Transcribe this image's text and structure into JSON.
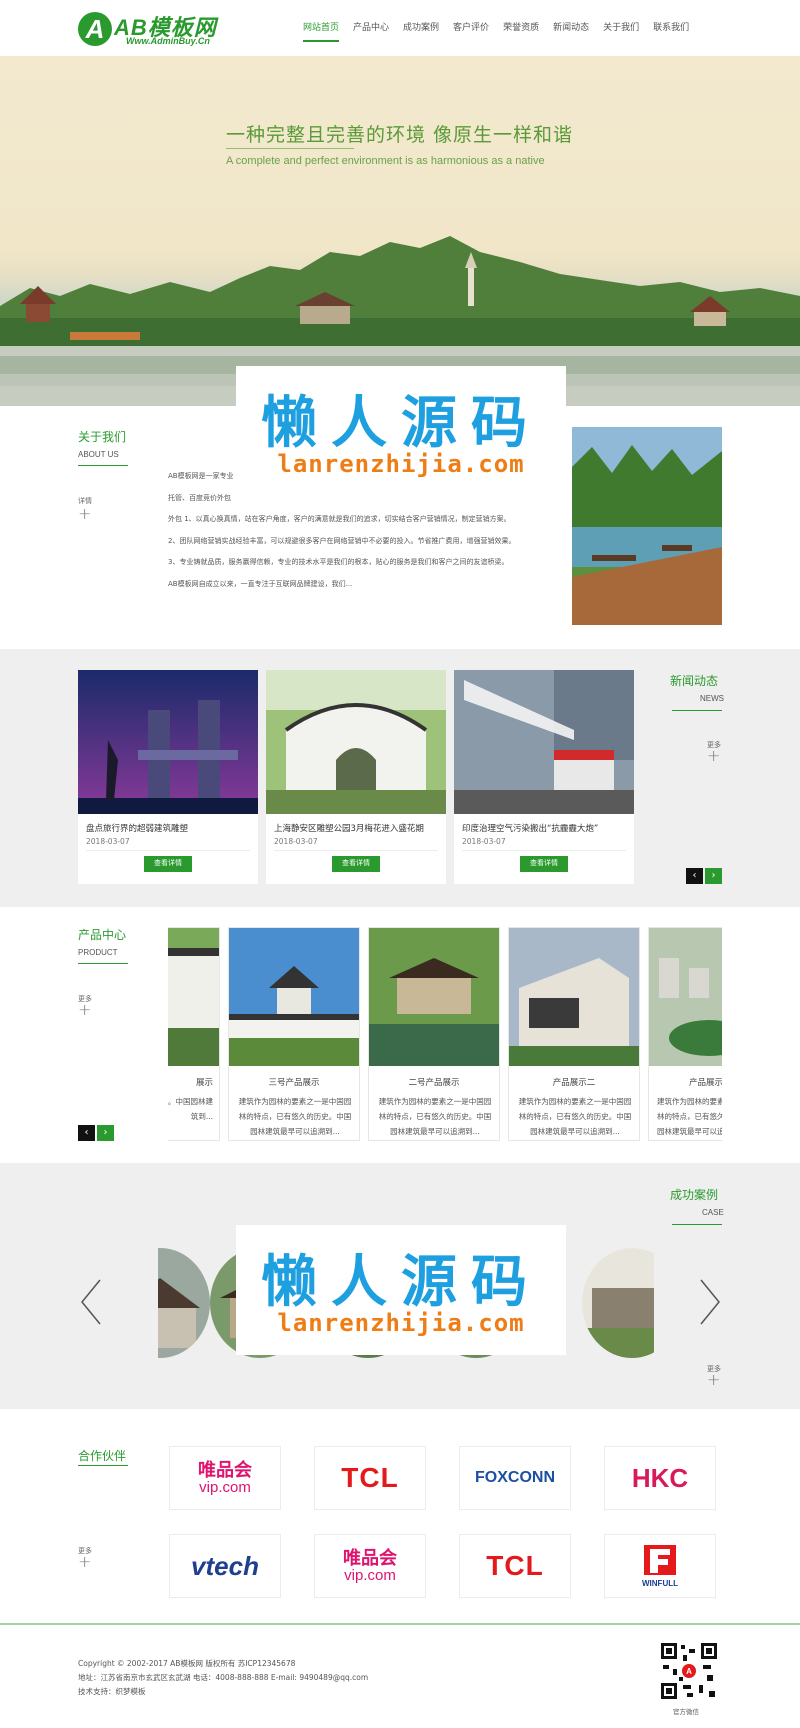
{
  "brand": {
    "logo_letter": "A",
    "name": "AB模板网",
    "url": "Www.AdminBuy.Cn",
    "primary_color": "#2a9a2e"
  },
  "nav": {
    "items": [
      {
        "label": "网站首页",
        "active": true
      },
      {
        "label": "产品中心"
      },
      {
        "label": "成功案例"
      },
      {
        "label": "客户评价"
      },
      {
        "label": "荣誉资质"
      },
      {
        "label": "新闻动态"
      },
      {
        "label": "关于我们"
      },
      {
        "label": "联系我们"
      }
    ]
  },
  "banner": {
    "headline": "一种完整且完善的环境  像原生一样和谐",
    "subline": "A complete and perfect environment is as harmonious as a native"
  },
  "watermark": {
    "cn": "懒人源码",
    "en": "lanrenzhijia.com"
  },
  "about": {
    "title_cn": "关于我们",
    "title_en": "ABOUT US",
    "more": "详情",
    "more_icon": "plus-icon",
    "paragraphs": [
      "AB模板网是一家专业",
      "托管、百度竞价外包",
      "外包 1、以真心换真情，站在客户角度，客户的满意就是我们的追求，切实结合客户营销情况，制定营销方案。",
      "2、团队网络营销实战经验丰富，可以规避很多客户在网络营销中不必要的投入。节省推广费用，增强营销效果。",
      "3、专业铸就品质，服务赢得信赖，专业的技术水平是我们的根本，贴心的服务是我们和客户之间的友谊桥梁。",
      "AB模板网自成立以来，一直专注于互联网品牌建设，我们..."
    ]
  },
  "news": {
    "title_cn": "新闻动态",
    "title_en": "NEWS",
    "more": "更多",
    "button_label": "查看详情",
    "items": [
      {
        "title": "盘点旅行界的超弱建筑雕塑",
        "date": "2018-03-07"
      },
      {
        "title": "上海静安区雕塑公园3月梅花进入盛花期",
        "date": "2018-03-07"
      },
      {
        "title": "印度治理空气污染搬出“抗霾霾大炮”",
        "date": "2018-03-07"
      }
    ],
    "prev_icon": "chevron-left-icon",
    "next_icon": "chevron-right-icon"
  },
  "products": {
    "title_cn": "产品中心",
    "title_en": "PRODUCT",
    "more": "更多",
    "items": [
      {
        "name": "展示",
        "desc": "之一是中国园的历史。中国园林建筑到..."
      },
      {
        "name": "三号产品展示",
        "desc": "建筑作为园林的要素之一是中国园林的特点，已有悠久的历史。中国园林建筑最早可以追溯到..."
      },
      {
        "name": "二号产品展示",
        "desc": "建筑作为园林的要素之一是中国园林的特点，已有悠久的历史。中国园林建筑最早可以追溯到..."
      },
      {
        "name": "产品展示二",
        "desc": "建筑作为园林的要素之一是中国园林的特点，已有悠久的历史。中国园林建筑最早可以追溯到..."
      },
      {
        "name": "产品展示",
        "desc": "建筑作为园林的要素之一是中国园林的特点，已有悠久的历史。中国园林建筑最早可以追溯到..."
      }
    ]
  },
  "cases": {
    "title_cn": "成功案例",
    "title_en": "CASE",
    "more": "更多"
  },
  "partners": {
    "title_cn": "合作伙伴",
    "more": "更多",
    "logos": [
      {
        "line1": "唯品会",
        "line2": "vip.com",
        "color": "#e0136f"
      },
      {
        "line1": "TCL",
        "line2": "",
        "color": "#e3191b"
      },
      {
        "line1": "FOXCONN",
        "line2": "",
        "color": "#1c4fa0"
      },
      {
        "line1": "HKC",
        "line2": "",
        "color": "#d81a5c"
      },
      {
        "line1": "vtech",
        "line2": "",
        "color": "#1f3f8f"
      },
      {
        "line1": "唯品会",
        "line2": "vip.com",
        "color": "#e0136f"
      },
      {
        "line1": "TCL",
        "line2": "",
        "color": "#e3191b"
      },
      {
        "line1": "WINFULL",
        "line2": "",
        "color": "#1a3c94"
      }
    ]
  },
  "footer": {
    "copyright": "Copyright © 2002-2017 AB模板网 版权所有 苏ICP12345678",
    "address": "地址：江苏省南京市玄武区玄武湖    电话：4008-888-888    E-mail: 9490489@qq.com",
    "support": "技术支持：织梦模板",
    "qr_caption": "官方微信"
  }
}
